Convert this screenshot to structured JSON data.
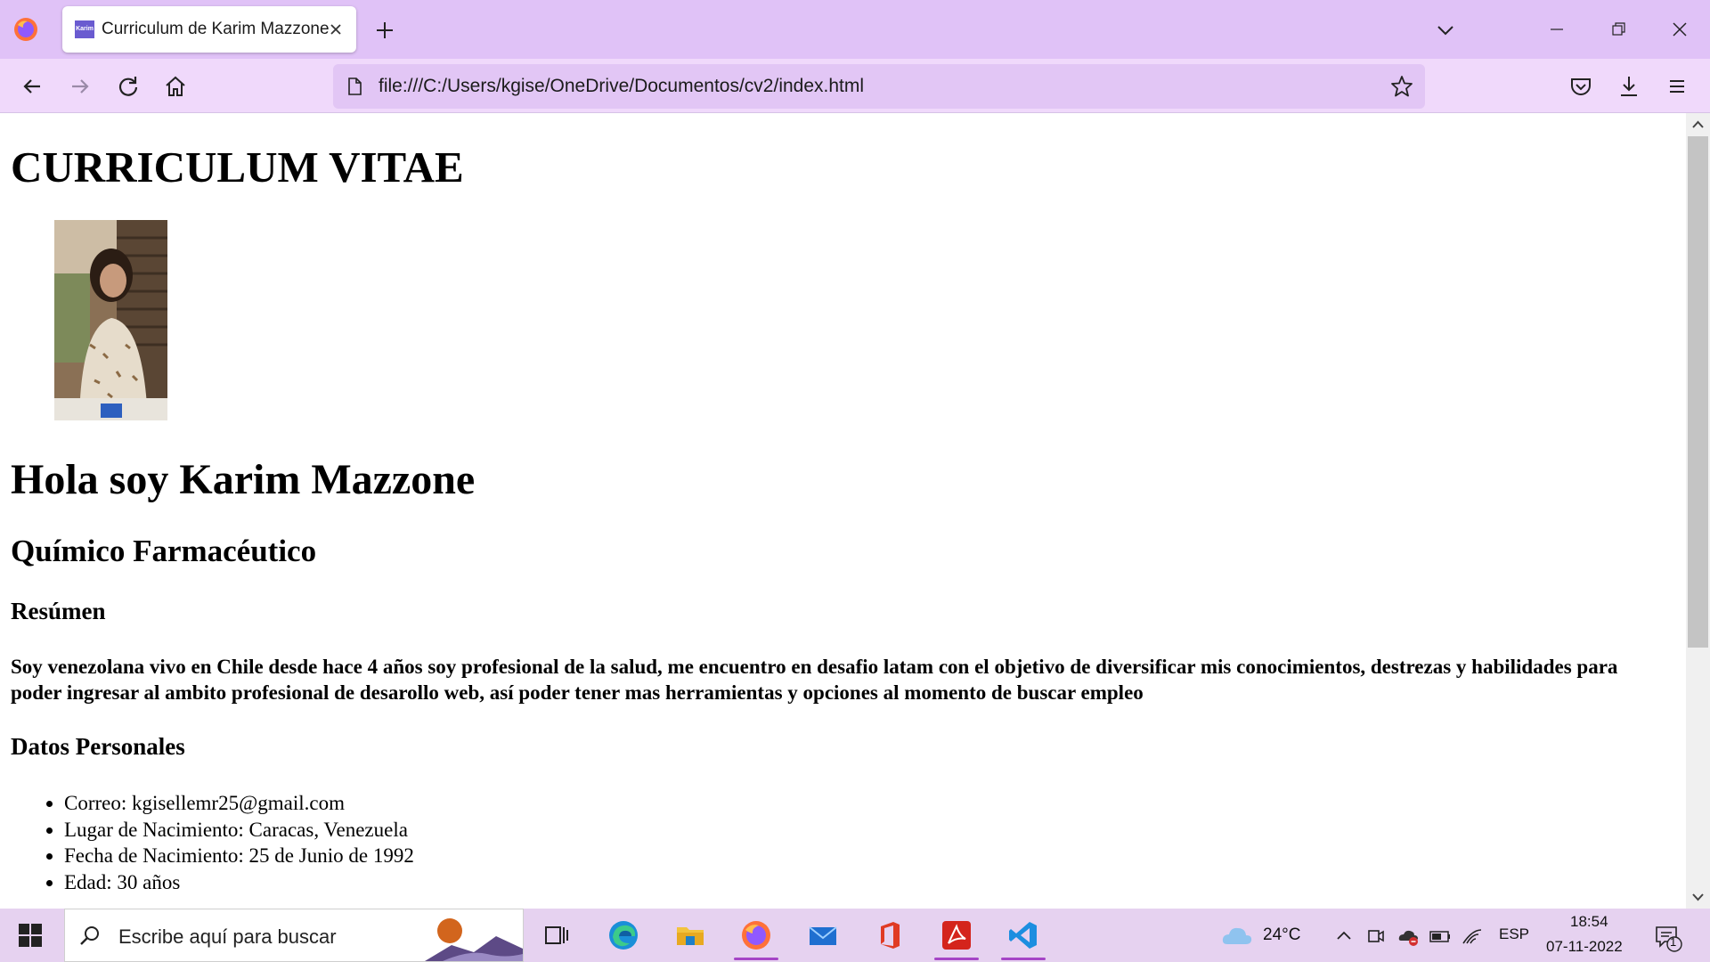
{
  "browser": {
    "tab_title": "Curriculum de Karim Mazzone",
    "favicon_text": "Karim",
    "url": "file:///C:/Users/kgise/OneDrive/Documentos/cv2/index.html",
    "accent_color": "#e0c2f7"
  },
  "page": {
    "heading": "CURRICULUM VITAE",
    "greeting": "Hola soy Karim Mazzone",
    "profession": "Químico Farmacéutico",
    "summary_title": "Resúmen",
    "summary": "Soy venezolana vivo en Chile desde hace 4 años soy profesional de la salud, me encuentro en desafio latam con el objetivo de diversificar mis conocimientos, destrezas y habilidades para poder ingresar al ambito profesional de desarollo web, así poder tener mas herramientas y opciones al momento de buscar empleo",
    "personal_title": "Datos Personales",
    "personal": [
      "Correo: kgisellemr25@gmail.com",
      "Lugar de Nacimiento: Caracas, Venezuela",
      "Fecha de Nacimiento: 25 de Junio de 1992",
      "Edad: 30 años"
    ]
  },
  "taskbar": {
    "search_placeholder": "Escribe aquí para buscar",
    "weather": "24°C",
    "language": "ESP",
    "time": "18:54",
    "date": "07-11-2022",
    "notification_count": "1",
    "apps": [
      "task-view",
      "edge",
      "file-explorer",
      "firefox",
      "mail",
      "office",
      "acrobat",
      "vscode"
    ]
  }
}
